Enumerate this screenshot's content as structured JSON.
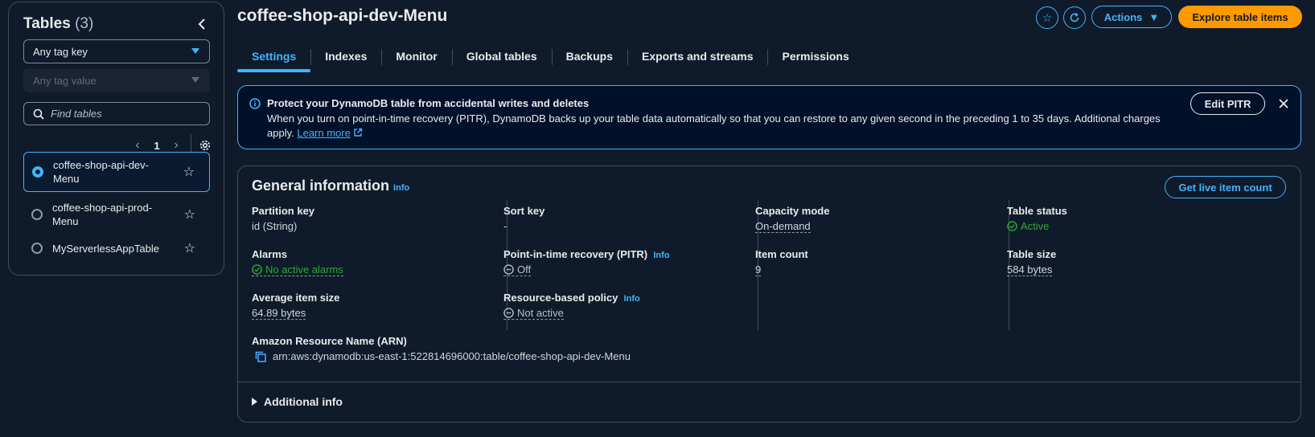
{
  "sidebar": {
    "title": "Tables",
    "count": "(3)",
    "tag_key": "Any tag key",
    "tag_value": "Any tag value",
    "search_placeholder": "Find tables",
    "page": "1",
    "tables": [
      {
        "name": "coffee-shop-api-dev-Menu",
        "selected": true
      },
      {
        "name": "coffee-shop-api-prod-Menu",
        "selected": false
      },
      {
        "name": "MyServerlessAppTable",
        "selected": false
      }
    ]
  },
  "header": {
    "title": "coffee-shop-api-dev-Menu",
    "actions_label": "Actions",
    "explore_label": "Explore table items"
  },
  "tabs": [
    "Settings",
    "Indexes",
    "Monitor",
    "Global tables",
    "Backups",
    "Exports and streams",
    "Permissions"
  ],
  "alert": {
    "title": "Protect your DynamoDB table from accidental writes and deletes",
    "body": "When you turn on point-in-time recovery (PITR), DynamoDB backs up your table data automatically so that you can restore to any given second in the preceding 1 to 35 days. Additional charges apply.",
    "link": "Learn more",
    "button": "Edit PITR"
  },
  "general": {
    "title": "General information",
    "info": "Info",
    "live_button": "Get live item count",
    "partition_key_label": "Partition key",
    "partition_key": "id (String)",
    "sort_key_label": "Sort key",
    "sort_key": "-",
    "capacity_label": "Capacity mode",
    "capacity": "On-demand",
    "status_label": "Table status",
    "status": "Active",
    "alarms_label": "Alarms",
    "alarms": "No active alarms",
    "pitr_label": "Point-in-time recovery (PITR)",
    "pitr": "Off",
    "item_count_label": "Item count",
    "item_count": "9",
    "table_size_label": "Table size",
    "table_size": "584 bytes",
    "avg_size_label": "Average item size",
    "avg_size": "64.89 bytes",
    "policy_label": "Resource-based policy",
    "policy": "Not active",
    "arn_label": "Amazon Resource Name (ARN)",
    "arn": "arn:aws:dynamodb:us-east-1:522814696000:table/coffee-shop-api-dev-Menu",
    "additional": "Additional info"
  },
  "colors": {
    "accent": "#42b4ff",
    "primary_button": "#ff9900",
    "success": "#29ad32",
    "background": "#0f1b2a"
  }
}
